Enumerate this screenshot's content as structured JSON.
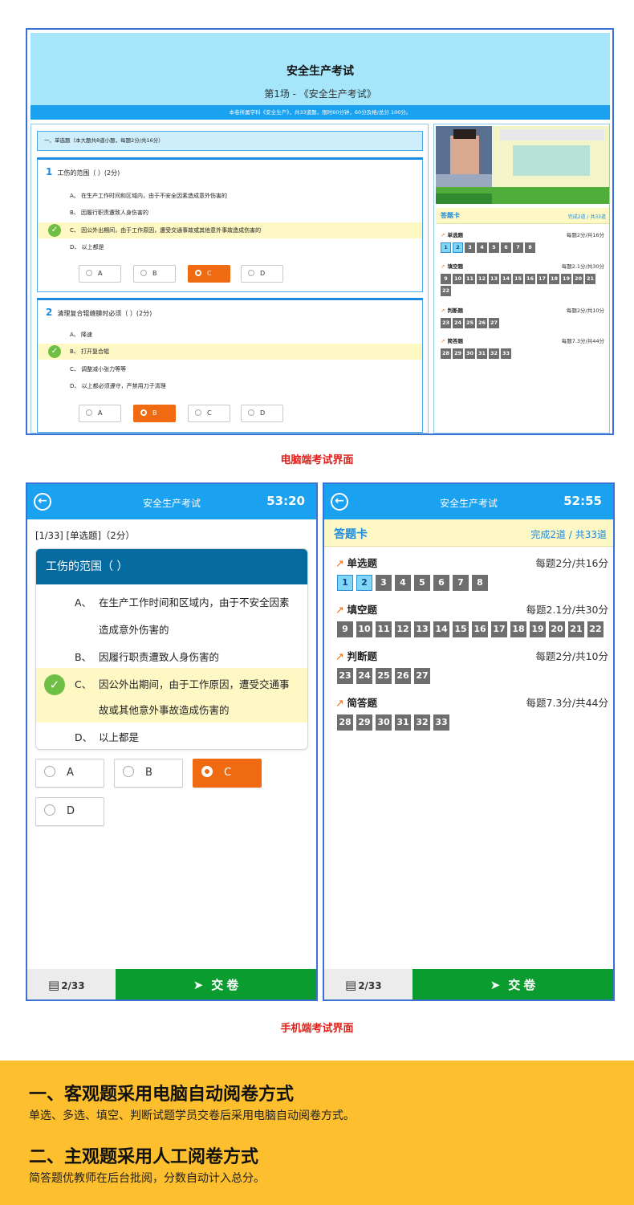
{
  "pc": {
    "title": "安全生产考试",
    "subtitle": "第1场 - 《安全生产考试》",
    "info": "本卷所属学科《安全生产》，共33道题，限时60分钟，60分及格/总分 100分。",
    "section": "一、单选题（本大题共8道小题，每题2分/共16分）",
    "q1": {
      "num": "1",
      "text": "工伤的范围（ ）(2分)",
      "options": [
        "A、 在生产工作时间和区域内，由于不安全因素造成意外伤害的",
        "B、 因履行职责遭致人身伤害的",
        "C、 因公外出期间，由于工作原因，遭受交通事故或其他意外事故造成伤害的",
        "D、 以上都是"
      ],
      "buttons": [
        "A",
        "B",
        "C",
        "D"
      ]
    },
    "q2": {
      "num": "2",
      "text": "清理复合辊缠膜时必须（ ）(2分)",
      "options": [
        "A、 降速",
        "B、 打开复合辊",
        "C、 调整减小张力等等",
        "D、 以上都必须遵守，严禁用刀子清理"
      ],
      "buttons": [
        "A",
        "B",
        "C",
        "D"
      ]
    },
    "card": {
      "title": "答题卡",
      "progress": "完成2道 / 共33道",
      "groups": [
        {
          "name": "单选题",
          "score": "每题2分/共16分",
          "nums": [
            "1",
            "2",
            "3",
            "4",
            "5",
            "6",
            "7",
            "8"
          ]
        },
        {
          "name": "填空题",
          "score": "每题2.1分/共30分",
          "nums": [
            "9",
            "10",
            "11",
            "12",
            "13",
            "14",
            "15",
            "16",
            "17",
            "18",
            "19",
            "20",
            "21",
            "22"
          ]
        },
        {
          "name": "判断题",
          "score": "每题2分/共10分",
          "nums": [
            "23",
            "24",
            "25",
            "26",
            "27"
          ]
        },
        {
          "name": "简答题",
          "score": "每题7.3分/共44分",
          "nums": [
            "28",
            "29",
            "30",
            "31",
            "32",
            "33"
          ]
        }
      ]
    }
  },
  "captions": {
    "pc": "电脑端考试界面",
    "mobile": "手机端考试界面"
  },
  "mobile1": {
    "title": "安全生产考试",
    "timer": "53:20",
    "meta": "[1/33] [单选题]（2分）",
    "question": "工伤的范围（ ）",
    "opts": [
      {
        "label": "A、",
        "text1": "在生产工作时间和区域内，由于不安全因素",
        "text2": "造成意外伤害的"
      },
      {
        "label": "B、",
        "text1": "因履行职责遭致人身伤害的",
        "text2": ""
      },
      {
        "label": "C、",
        "text1": "因公外出期间，由于工作原因，遭受交通事",
        "text2": "故或其他意外事故造成伤害的"
      },
      {
        "label": "D、",
        "text1": "以上都是",
        "text2": ""
      }
    ],
    "buttons": [
      "A",
      "B",
      "C",
      "D"
    ],
    "count": "2/33",
    "submit": "交卷"
  },
  "mobile2": {
    "title": "安全生产考试",
    "timer": "52:55",
    "count": "2/33",
    "submit": "交卷"
  },
  "band": {
    "h1": "一、客观题采用电脑自动阅卷方式",
    "p1": "单选、多选、填空、判断试题学员交卷后采用电脑自动阅卷方式。",
    "h2": "二、主观题采用人工阅卷方式",
    "p2": "简答题优教师在后台批阅，分数自动计入总分。"
  },
  "colors": {
    "accent": "#1aa1f0",
    "orange": "#ef6a10",
    "green": "#0a9c2e",
    "band": "#fdbf2d",
    "highlight": "#fdf8c4"
  }
}
